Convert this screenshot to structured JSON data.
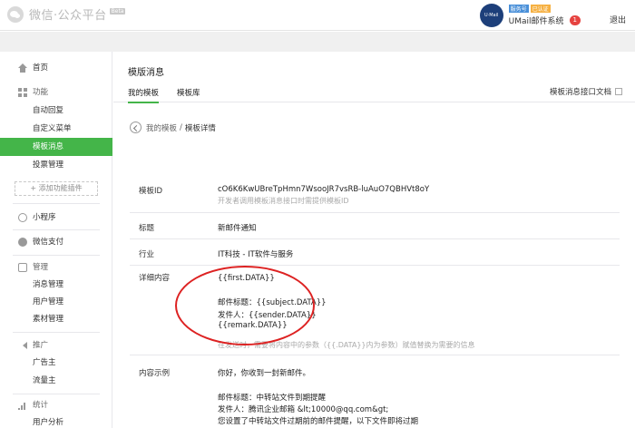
{
  "header": {
    "logo_text": "微信·公众平台",
    "beta_label": "Beta",
    "account_avatar_text": "U·Mail",
    "badge_service": "服务号",
    "badge_verified": "已认证",
    "account_name": "UMail邮件系统",
    "notification_count": "1",
    "logout_label": "退出"
  },
  "sidebar": {
    "home": "首页",
    "features_section": "功能",
    "features": [
      "自动回复",
      "自定义菜单",
      "模板消息",
      "投票管理"
    ],
    "add_plugin": "+ 添加功能插件",
    "mini_program": "小程序",
    "wechat_pay": "微信支付",
    "manage_section": "管理",
    "manage": [
      "消息管理",
      "用户管理",
      "素材管理"
    ],
    "promote_section": "推广",
    "promote": [
      "广告主",
      "流量主"
    ],
    "stats_section": "统计",
    "stats": [
      "用户分析"
    ]
  },
  "main": {
    "page_title": "模版消息",
    "tabs": [
      "我的模板",
      "模板库"
    ],
    "doc_link": "模板消息接口文档",
    "breadcrumb": {
      "parent": "我的模板",
      "separator": "/",
      "current": "模板详情"
    },
    "rows": {
      "template_id_label": "模板ID",
      "template_id_value": "cO6K6KwUBreTpHmn7WsooJR7vsRB-luAuO7QBHVt8oY",
      "template_id_hint": "开发者调用模板消息接口时需提供模板ID",
      "title_label": "标题",
      "title_value": "新邮件通知",
      "industry_label": "行业",
      "industry_value": "IT科技 - IT软件与服务",
      "content_label": "详细内容",
      "content_lines": [
        "{{first.DATA}}",
        "邮件标题：{{subject.DATA}}",
        "发件人：{{sender.DATA}}",
        "{{remark.DATA}}"
      ],
      "content_hint": "在发送时，需要将内容中的参数（{{.DATA}}内为参数）赋值替换为需要的信息",
      "example_label": "内容示例",
      "example_lines": [
        "你好，你收到一封新邮件。",
        "邮件标题：中转站文件到期提醒",
        "发件人：腾讯企业邮箱 &lt;10000@qq.com&gt;",
        "您设置了中转站文件过期前的邮件提醒，以下文件即将过期"
      ]
    }
  },
  "colors": {
    "accent_green": "#44b549",
    "annotation_red": "#dd2222",
    "notif_red": "#e64340"
  }
}
